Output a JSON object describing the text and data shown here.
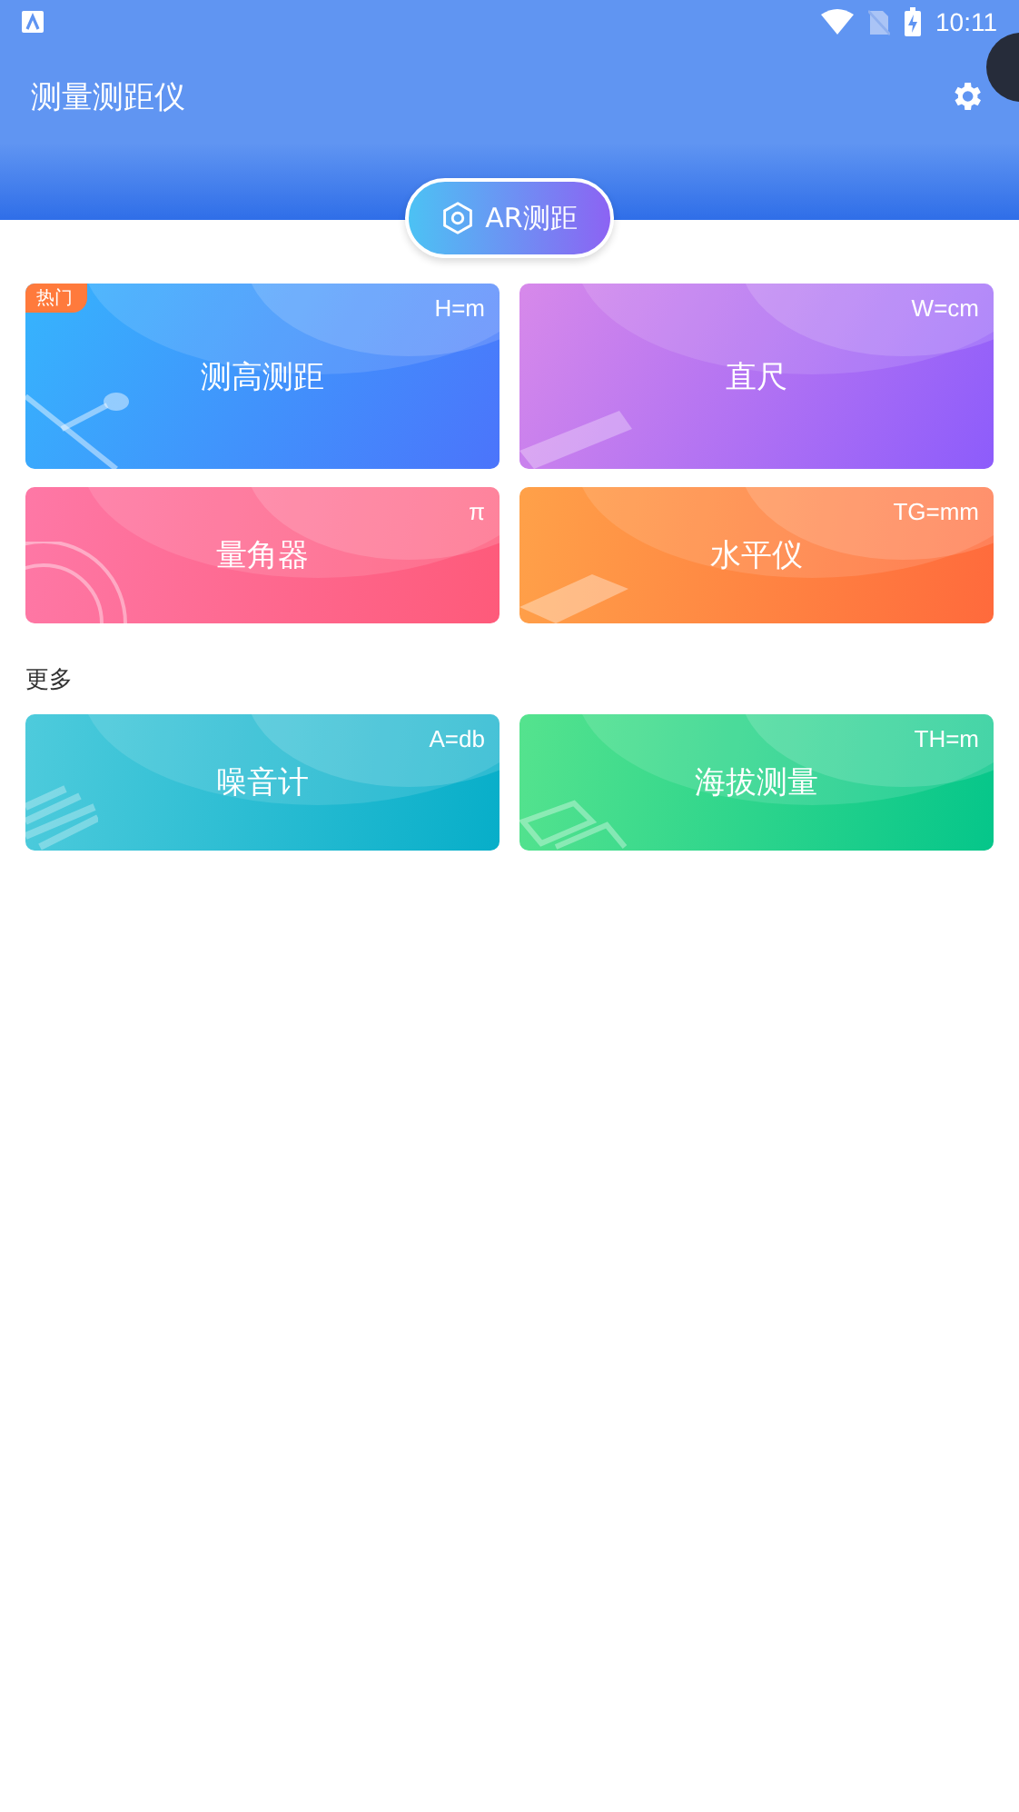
{
  "status_bar": {
    "time": "10:11"
  },
  "header": {
    "title": "测量测距仪"
  },
  "ar_button": {
    "label": "AR测距"
  },
  "tools": [
    {
      "kind": "distance",
      "title": "测高测距",
      "unit": "H=m",
      "hot": true,
      "badge": "热门"
    },
    {
      "kind": "ruler",
      "title": "直尺",
      "unit": "W=cm",
      "hot": false
    },
    {
      "kind": "protractor",
      "title": "量角器",
      "unit": "π",
      "hot": false
    },
    {
      "kind": "level",
      "title": "水平仪",
      "unit": "TG=mm",
      "hot": false
    }
  ],
  "more": {
    "heading": "更多",
    "tools": [
      {
        "kind": "noise",
        "title": "噪音计",
        "unit": "A=db",
        "hot": false
      },
      {
        "kind": "altitude",
        "title": "海拔测量",
        "unit": "TH=m",
        "hot": false
      }
    ]
  }
}
